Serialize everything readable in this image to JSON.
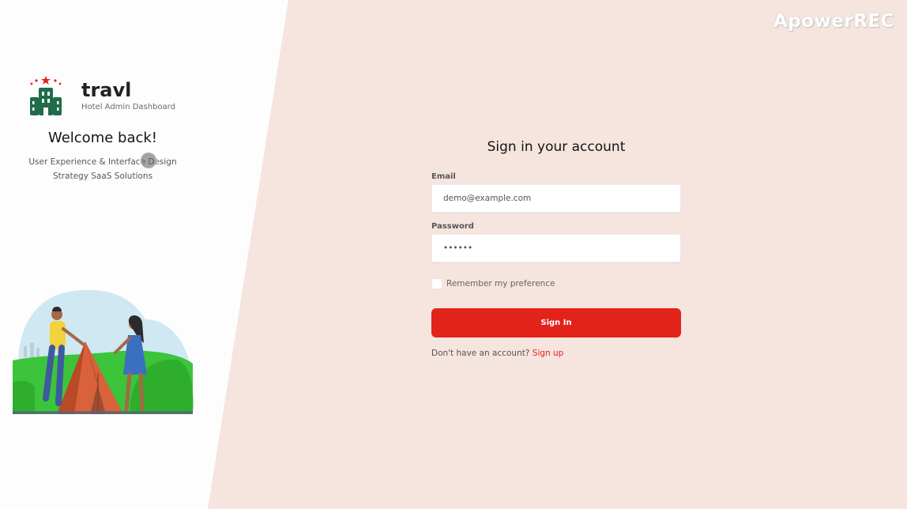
{
  "watermark": "ApowerREC",
  "brand": {
    "name": "travl",
    "subtitle": "Hotel Admin Dashboard"
  },
  "welcome": {
    "title": "Welcome back!",
    "line1": "User Experience & Interface Design",
    "line2": "Strategy SaaS Solutions"
  },
  "form": {
    "title": "Sign in your account",
    "email_label": "Email",
    "email_value": "demo@example.com",
    "password_label": "Password",
    "password_value": "123456",
    "remember_label": "Remember my preference",
    "remember_checked": false,
    "submit_label": "Sign In",
    "signup_prompt": "Don't have an account?",
    "signup_link": "Sign up"
  },
  "colors": {
    "accent": "#e2231a",
    "logo_green": "#1f6b4a",
    "right_background": "#f6e4df"
  }
}
